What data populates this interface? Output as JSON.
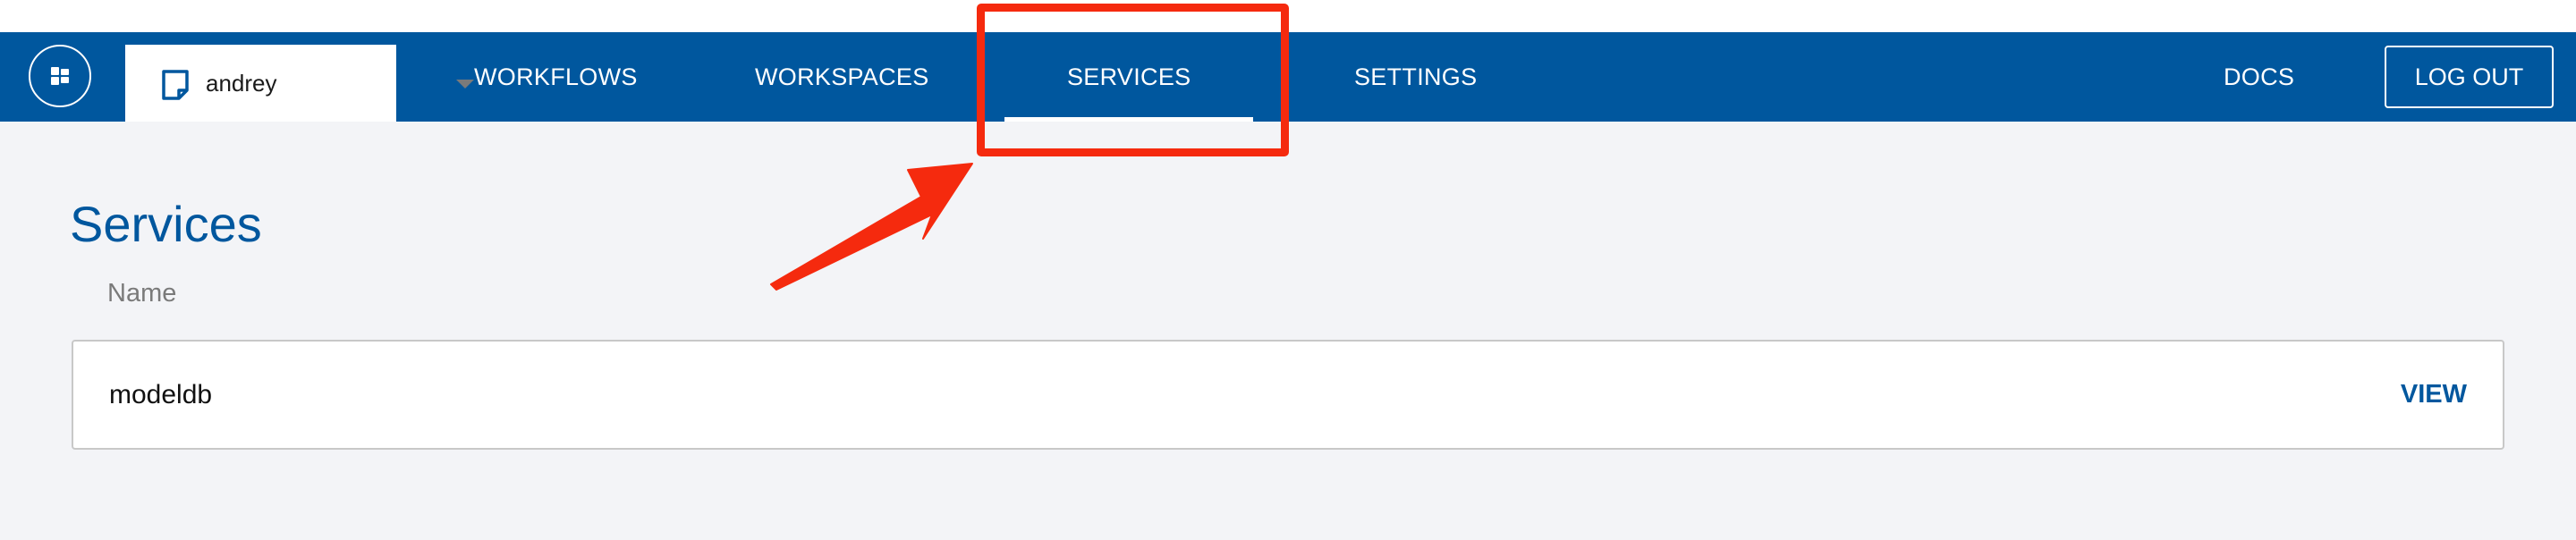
{
  "navbar": {
    "workspace_name": "andrey",
    "tabs": [
      {
        "label": "WORKFLOWS"
      },
      {
        "label": "WORKSPACES"
      },
      {
        "label": "SERVICES",
        "active": true
      },
      {
        "label": "SETTINGS"
      }
    ],
    "docs_label": "DOCS",
    "logout_label": "LOG OUT",
    "icons": {
      "logo": "app-logo-icon",
      "workspace": "document-icon",
      "caret": "caret-down-icon"
    }
  },
  "main": {
    "title": "Services",
    "column_header": "Name",
    "services": [
      {
        "name": "modeldb",
        "action": "VIEW"
      }
    ]
  },
  "annotation": {
    "highlight_color": "#f52a0e",
    "highlights": [
      "services-tab"
    ]
  },
  "colors": {
    "brand": "#00579e",
    "background": "#f3f4f7",
    "annotation": "#f52a0e"
  }
}
